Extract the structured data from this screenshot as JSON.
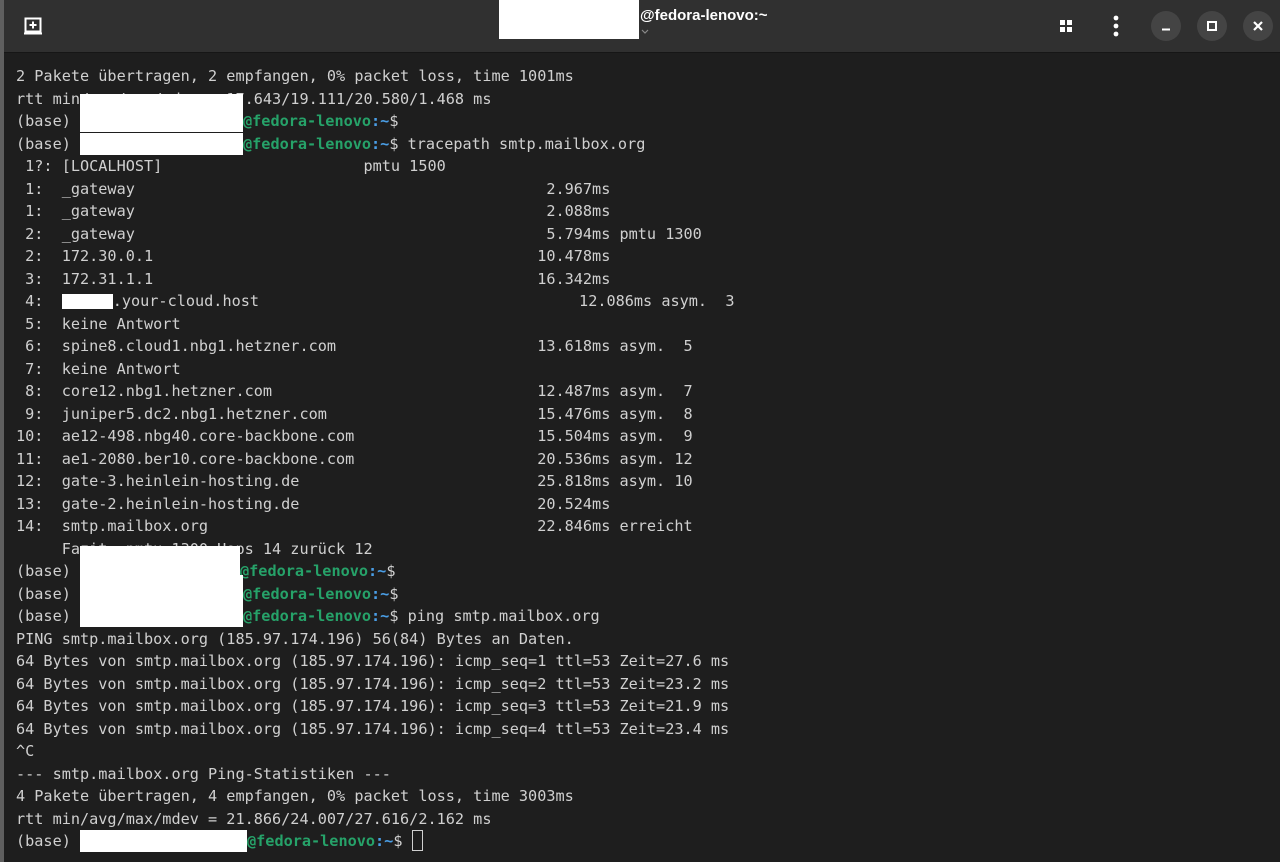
{
  "window": {
    "title": "@fedora-lenovo:~"
  },
  "colors": {
    "user_host": "#26a269",
    "path": "#4a9ee6",
    "text": "#d0d0d0",
    "background": "#1e1e1e"
  },
  "prompt": {
    "prefix": "(base) ",
    "host": "@fedora-lenovo",
    "path": ":~",
    "dollar": "$ "
  },
  "output": {
    "ping1_sent": "2 Pakete übertragen, 2 empfangen, 0% packet loss, time 1001ms",
    "ping1_rtt": "rtt min/avg/max/mdev = 17.643/19.111/20.580/1.468 ms",
    "cmd_tracepath": "tracepath smtp.mailbox.org",
    "trace": [
      " 1?: [LOCALHOST]                      pmtu 1500",
      " 1:  _gateway                                             2.967ms",
      " 1:  _gateway                                             2.088ms",
      " 2:  _gateway                                             5.794ms pmtu 1300",
      " 2:  172.30.0.1                                          10.478ms",
      " 3:  172.31.1.1                                          16.342ms"
    ],
    "trace_hop4_num": " 4:  ",
    "trace_hop4_rest": ".your-cloud.host                                   12.086ms asym.  3",
    "trace2": [
      " 5:  keine Antwort",
      " 6:  spine8.cloud1.nbg1.hetzner.com                      13.618ms asym.  5",
      " 7:  keine Antwort",
      " 8:  core12.nbg1.hetzner.com                             12.487ms asym.  7",
      " 9:  juniper5.dc2.nbg1.hetzner.com                       15.476ms asym.  8",
      "10:  ae12-498.nbg40.core-backbone.com                    15.504ms asym.  9",
      "11:  ae1-2080.ber10.core-backbone.com                    20.536ms asym. 12",
      "12:  gate-3.heinlein-hosting.de                          25.818ms asym. 10",
      "13:  gate-2.heinlein-hosting.de                          20.524ms",
      "14:  smtp.mailbox.org                                    22.846ms erreicht",
      "     Fazit: pmtu 1300 Hops 14 zurück 12"
    ],
    "cmd_ping": "ping smtp.mailbox.org",
    "ping2": [
      "PING smtp.mailbox.org (185.97.174.196) 56(84) Bytes an Daten.",
      "64 Bytes von smtp.mailbox.org (185.97.174.196): icmp_seq=1 ttl=53 Zeit=27.6 ms",
      "64 Bytes von smtp.mailbox.org (185.97.174.196): icmp_seq=2 ttl=53 Zeit=23.2 ms",
      "64 Bytes von smtp.mailbox.org (185.97.174.196): icmp_seq=3 ttl=53 Zeit=21.9 ms",
      "64 Bytes von smtp.mailbox.org (185.97.174.196): icmp_seq=4 ttl=53 Zeit=23.4 ms",
      "^C",
      "--- smtp.mailbox.org Ping-Statistiken ---",
      "4 Pakete übertragen, 4 empfangen, 0% packet loss, time 3003ms",
      "rtt min/avg/max/mdev = 21.866/24.007/27.616/2.162 ms"
    ]
  }
}
